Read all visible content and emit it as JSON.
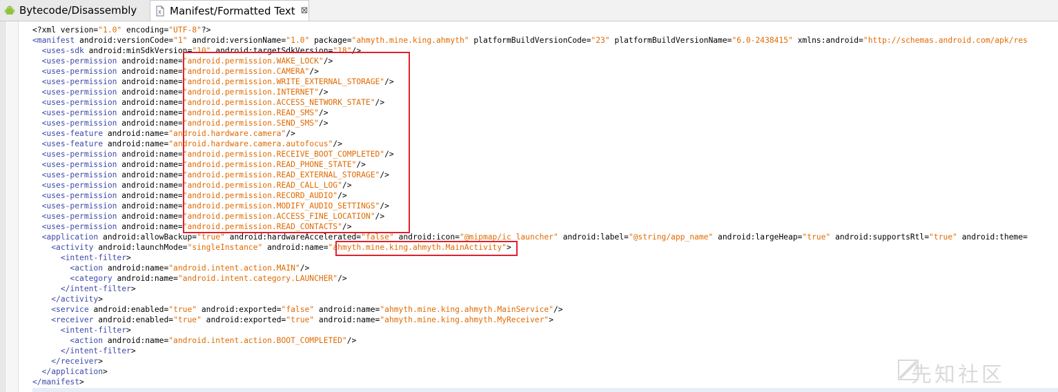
{
  "tabs": [
    {
      "label": "Bytecode/Disassembly",
      "icon": "android-icon"
    },
    {
      "label": "Manifest/Formatted Text",
      "icon": "xml-file-icon",
      "close": "⊠"
    }
  ],
  "watermark": "先知社区",
  "code_lines": [
    [
      [
        "a",
        "<?xml version="
      ],
      [
        "v",
        "\"1.0\""
      ],
      [
        "a",
        " encoding="
      ],
      [
        "v",
        "\"UTF-8\""
      ],
      [
        "a",
        "?>"
      ]
    ],
    [
      [
        "t",
        "<manifest"
      ],
      [
        "a",
        " android:versionCode="
      ],
      [
        "v",
        "\"1\""
      ],
      [
        "a",
        " android:versionName="
      ],
      [
        "v",
        "\"1.0\""
      ],
      [
        "a",
        " package="
      ],
      [
        "v",
        "\"ahmyth.mine.king.ahmyth\""
      ],
      [
        "a",
        " platformBuildVersionCode="
      ],
      [
        "v",
        "\"23\""
      ],
      [
        "a",
        " platformBuildVersionName="
      ],
      [
        "v",
        "\"6.0-2438415\""
      ],
      [
        "a",
        " xmlns:android="
      ],
      [
        "v",
        "\"http://schemas.android.com/apk/res"
      ]
    ],
    [
      [
        "a",
        "  "
      ],
      [
        "t",
        "<uses-sdk"
      ],
      [
        "a",
        " android:minSdkVersion="
      ],
      [
        "v",
        "\"10\""
      ],
      [
        "a",
        " android:targetSdkVersion="
      ],
      [
        "v",
        "\"18\""
      ],
      [
        "a",
        "/>"
      ]
    ],
    [
      [
        "a",
        "  "
      ],
      [
        "t",
        "<uses-permission"
      ],
      [
        "a",
        " android:name="
      ],
      [
        "v",
        "\"android.permission.WAKE_LOCK\""
      ],
      [
        "a",
        "/>"
      ]
    ],
    [
      [
        "a",
        "  "
      ],
      [
        "t",
        "<uses-permission"
      ],
      [
        "a",
        " android:name="
      ],
      [
        "v",
        "\"android.permission.CAMERA\""
      ],
      [
        "a",
        "/>"
      ]
    ],
    [
      [
        "a",
        "  "
      ],
      [
        "t",
        "<uses-permission"
      ],
      [
        "a",
        " android:name="
      ],
      [
        "v",
        "\"android.permission.WRITE_EXTERNAL_STORAGE\""
      ],
      [
        "a",
        "/>"
      ]
    ],
    [
      [
        "a",
        "  "
      ],
      [
        "t",
        "<uses-permission"
      ],
      [
        "a",
        " android:name="
      ],
      [
        "v",
        "\"android.permission.INTERNET\""
      ],
      [
        "a",
        "/>"
      ]
    ],
    [
      [
        "a",
        "  "
      ],
      [
        "t",
        "<uses-permission"
      ],
      [
        "a",
        " android:name="
      ],
      [
        "v",
        "\"android.permission.ACCESS_NETWORK_STATE\""
      ],
      [
        "a",
        "/>"
      ]
    ],
    [
      [
        "a",
        "  "
      ],
      [
        "t",
        "<uses-permission"
      ],
      [
        "a",
        " android:name="
      ],
      [
        "v",
        "\"android.permission.READ_SMS\""
      ],
      [
        "a",
        "/>"
      ]
    ],
    [
      [
        "a",
        "  "
      ],
      [
        "t",
        "<uses-permission"
      ],
      [
        "a",
        " android:name="
      ],
      [
        "v",
        "\"android.permission.SEND_SMS\""
      ],
      [
        "a",
        "/>"
      ]
    ],
    [
      [
        "a",
        "  "
      ],
      [
        "t",
        "<uses-feature"
      ],
      [
        "a",
        " android:name="
      ],
      [
        "v",
        "\"android.hardware.camera\""
      ],
      [
        "a",
        "/>"
      ]
    ],
    [
      [
        "a",
        "  "
      ],
      [
        "t",
        "<uses-feature"
      ],
      [
        "a",
        " android:name="
      ],
      [
        "v",
        "\"android.hardware.camera.autofocus\""
      ],
      [
        "a",
        "/>"
      ]
    ],
    [
      [
        "a",
        "  "
      ],
      [
        "t",
        "<uses-permission"
      ],
      [
        "a",
        " android:name="
      ],
      [
        "v",
        "\"android.permission.RECEIVE_BOOT_COMPLETED\""
      ],
      [
        "a",
        "/>"
      ]
    ],
    [
      [
        "a",
        "  "
      ],
      [
        "t",
        "<uses-permission"
      ],
      [
        "a",
        " android:name="
      ],
      [
        "v",
        "\"android.permission.READ_PHONE_STATE\""
      ],
      [
        "a",
        "/>"
      ]
    ],
    [
      [
        "a",
        "  "
      ],
      [
        "t",
        "<uses-permission"
      ],
      [
        "a",
        " android:name="
      ],
      [
        "v",
        "\"android.permission.READ_EXTERNAL_STORAGE\""
      ],
      [
        "a",
        "/>"
      ]
    ],
    [
      [
        "a",
        "  "
      ],
      [
        "t",
        "<uses-permission"
      ],
      [
        "a",
        " android:name="
      ],
      [
        "v",
        "\"android.permission.READ_CALL_LOG\""
      ],
      [
        "a",
        "/>"
      ]
    ],
    [
      [
        "a",
        "  "
      ],
      [
        "t",
        "<uses-permission"
      ],
      [
        "a",
        " android:name="
      ],
      [
        "v",
        "\"android.permission.RECORD_AUDIO\""
      ],
      [
        "a",
        "/>"
      ]
    ],
    [
      [
        "a",
        "  "
      ],
      [
        "t",
        "<uses-permission"
      ],
      [
        "a",
        " android:name="
      ],
      [
        "v",
        "\"android.permission.MODIFY_AUDIO_SETTINGS\""
      ],
      [
        "a",
        "/>"
      ]
    ],
    [
      [
        "a",
        "  "
      ],
      [
        "t",
        "<uses-permission"
      ],
      [
        "a",
        " android:name="
      ],
      [
        "v",
        "\"android.permission.ACCESS_FINE_LOCATION\""
      ],
      [
        "a",
        "/>"
      ]
    ],
    [
      [
        "a",
        "  "
      ],
      [
        "t",
        "<uses-permission"
      ],
      [
        "a",
        " android:name="
      ],
      [
        "v",
        "\"android.permission.READ_CONTACTS\""
      ],
      [
        "a",
        "/>"
      ]
    ],
    [
      [
        "a",
        "  "
      ],
      [
        "t",
        "<application"
      ],
      [
        "a",
        " android:allowBackup="
      ],
      [
        "v",
        "\"true\""
      ],
      [
        "a",
        " android:hardwareAccelerated="
      ],
      [
        "v",
        "\"false\""
      ],
      [
        "a",
        " android:icon="
      ],
      [
        "v",
        "\"@mipmap/ic_launcher\""
      ],
      [
        "a",
        " android:label="
      ],
      [
        "v",
        "\"@string/app_name\""
      ],
      [
        "a",
        " android:largeHeap="
      ],
      [
        "v",
        "\"true\""
      ],
      [
        "a",
        " android:supportsRtl="
      ],
      [
        "v",
        "\"true\""
      ],
      [
        "a",
        " android:theme="
      ]
    ],
    [
      [
        "a",
        "    "
      ],
      [
        "t",
        "<activity"
      ],
      [
        "a",
        " android:launchMode="
      ],
      [
        "v",
        "\"singleInstance\""
      ],
      [
        "a",
        " android:name="
      ],
      [
        "v",
        "\"ahmyth.mine.king.ahmyth.MainActivity\""
      ],
      [
        "a",
        ">"
      ]
    ],
    [
      [
        "a",
        "      "
      ],
      [
        "t",
        "<intent-filter"
      ],
      [
        "a",
        ">"
      ]
    ],
    [
      [
        "a",
        "        "
      ],
      [
        "t",
        "<action"
      ],
      [
        "a",
        " android:name="
      ],
      [
        "v",
        "\"android.intent.action.MAIN\""
      ],
      [
        "a",
        "/>"
      ]
    ],
    [
      [
        "a",
        "        "
      ],
      [
        "t",
        "<category"
      ],
      [
        "a",
        " android:name="
      ],
      [
        "v",
        "\"android.intent.category.LAUNCHER\""
      ],
      [
        "a",
        "/>"
      ]
    ],
    [
      [
        "a",
        "      "
      ],
      [
        "t",
        "</intent-filter"
      ],
      [
        "a",
        ">"
      ]
    ],
    [
      [
        "a",
        "    "
      ],
      [
        "t",
        "</activity"
      ],
      [
        "a",
        ">"
      ]
    ],
    [
      [
        "a",
        "    "
      ],
      [
        "t",
        "<service"
      ],
      [
        "a",
        " android:enabled="
      ],
      [
        "v",
        "\"true\""
      ],
      [
        "a",
        " android:exported="
      ],
      [
        "v",
        "\"false\""
      ],
      [
        "a",
        " android:name="
      ],
      [
        "v",
        "\"ahmyth.mine.king.ahmyth.MainService\""
      ],
      [
        "a",
        "/>"
      ]
    ],
    [
      [
        "a",
        "    "
      ],
      [
        "t",
        "<receiver"
      ],
      [
        "a",
        " android:enabled="
      ],
      [
        "v",
        "\"true\""
      ],
      [
        "a",
        " android:exported="
      ],
      [
        "v",
        "\"true\""
      ],
      [
        "a",
        " android:name="
      ],
      [
        "v",
        "\"ahmyth.mine.king.ahmyth.MyReceiver\""
      ],
      [
        "a",
        ">"
      ]
    ],
    [
      [
        "a",
        "      "
      ],
      [
        "t",
        "<intent-filter"
      ],
      [
        "a",
        ">"
      ]
    ],
    [
      [
        "a",
        "        "
      ],
      [
        "t",
        "<action"
      ],
      [
        "a",
        " android:name="
      ],
      [
        "v",
        "\"android.intent.action.BOOT_COMPLETED\""
      ],
      [
        "a",
        "/>"
      ]
    ],
    [
      [
        "a",
        "      "
      ],
      [
        "t",
        "</intent-filter"
      ],
      [
        "a",
        ">"
      ]
    ],
    [
      [
        "a",
        "    "
      ],
      [
        "t",
        "</receiver"
      ],
      [
        "a",
        ">"
      ]
    ],
    [
      [
        "a",
        "  "
      ],
      [
        "t",
        "</application"
      ],
      [
        "a",
        ">"
      ]
    ],
    [
      [
        "t",
        "</manifest"
      ],
      [
        "a",
        ">"
      ]
    ]
  ],
  "colors": {
    "tag": "#3c48a8",
    "value": "#e06a00",
    "highlight": "#e0202a"
  }
}
